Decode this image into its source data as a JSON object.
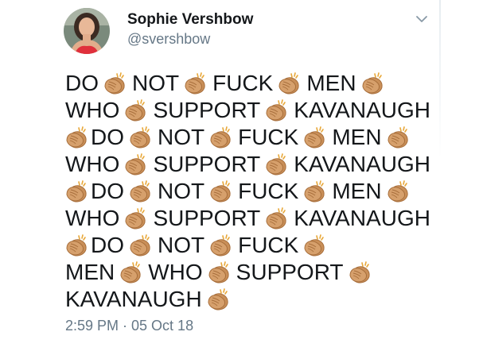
{
  "tweet": {
    "author": {
      "display_name": "Sophie Vershbow",
      "handle": "@svershbow"
    },
    "lines": [
      {
        "lead_clap": false,
        "words": [
          "DO",
          "NOT",
          "FUCK",
          "MEN"
        ],
        "trailing_clap": true
      },
      {
        "lead_clap": false,
        "words": [
          "WHO",
          "SUPPORT",
          "KAVANAUGH"
        ],
        "trailing_clap": false
      },
      {
        "lead_clap": true,
        "words": [
          "DO",
          "NOT",
          "FUCK",
          "MEN"
        ],
        "trailing_clap": true
      },
      {
        "lead_clap": false,
        "words": [
          "WHO",
          "SUPPORT",
          "KAVANAUGH"
        ],
        "trailing_clap": false
      },
      {
        "lead_clap": true,
        "words": [
          "DO",
          "NOT",
          "FUCK",
          "MEN"
        ],
        "trailing_clap": true
      },
      {
        "lead_clap": false,
        "words": [
          "WHO",
          "SUPPORT",
          "KAVANAUGH"
        ],
        "trailing_clap": false
      },
      {
        "lead_clap": true,
        "words": [
          "DO",
          "NOT",
          "FUCK"
        ],
        "trailing_clap": true
      },
      {
        "lead_clap": false,
        "words": [
          "MEN",
          "WHO",
          "SUPPORT"
        ],
        "trailing_clap": true
      },
      {
        "lead_clap": false,
        "words": [
          "KAVANAUGH"
        ],
        "trailing_clap": true
      }
    ],
    "timestamp": "2:59 PM · 05 Oct 18"
  },
  "icons": {
    "separator": "clapping-hands-icon",
    "menu": "chevron-down-icon"
  },
  "colors": {
    "text": "#14171a",
    "secondary": "#657786",
    "clap_skin": "#d6a06c",
    "clap_outline": "#a86f3c"
  }
}
